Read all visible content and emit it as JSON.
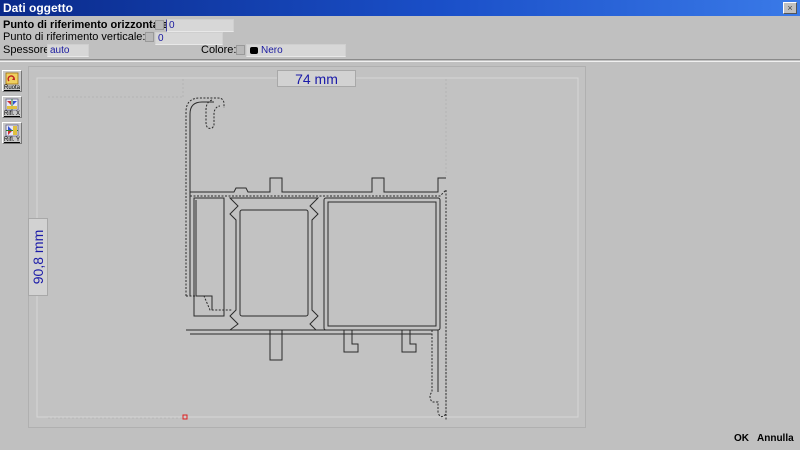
{
  "window": {
    "title": "Dati oggetto",
    "close_glyph": "×"
  },
  "fields": {
    "horizontal": {
      "label": "Punto di riferimento orizzontale:",
      "value": "0"
    },
    "vertical": {
      "label": "Punto di riferimento verticale:",
      "value": "0"
    },
    "thickness": {
      "label": "Spessore:",
      "value": "auto"
    },
    "color": {
      "label": "Colore:",
      "value": "Nero",
      "swatch": "#000000"
    }
  },
  "tools": [
    {
      "label": "Ruota",
      "icon": "rotate-icon"
    },
    {
      "label": "Rifl. X",
      "icon": "mirror-x-icon"
    },
    {
      "label": "Rifl. Y",
      "icon": "mirror-y-icon"
    }
  ],
  "dimensions": {
    "width": "74 mm",
    "height": "90,8 mm"
  },
  "buttons": {
    "ok": "OK",
    "cancel": "Annulla"
  },
  "colors": {
    "dimension_text": "#1a1aa8",
    "title_bar": "#1a4fc8",
    "origin_marker": "#e02020"
  }
}
